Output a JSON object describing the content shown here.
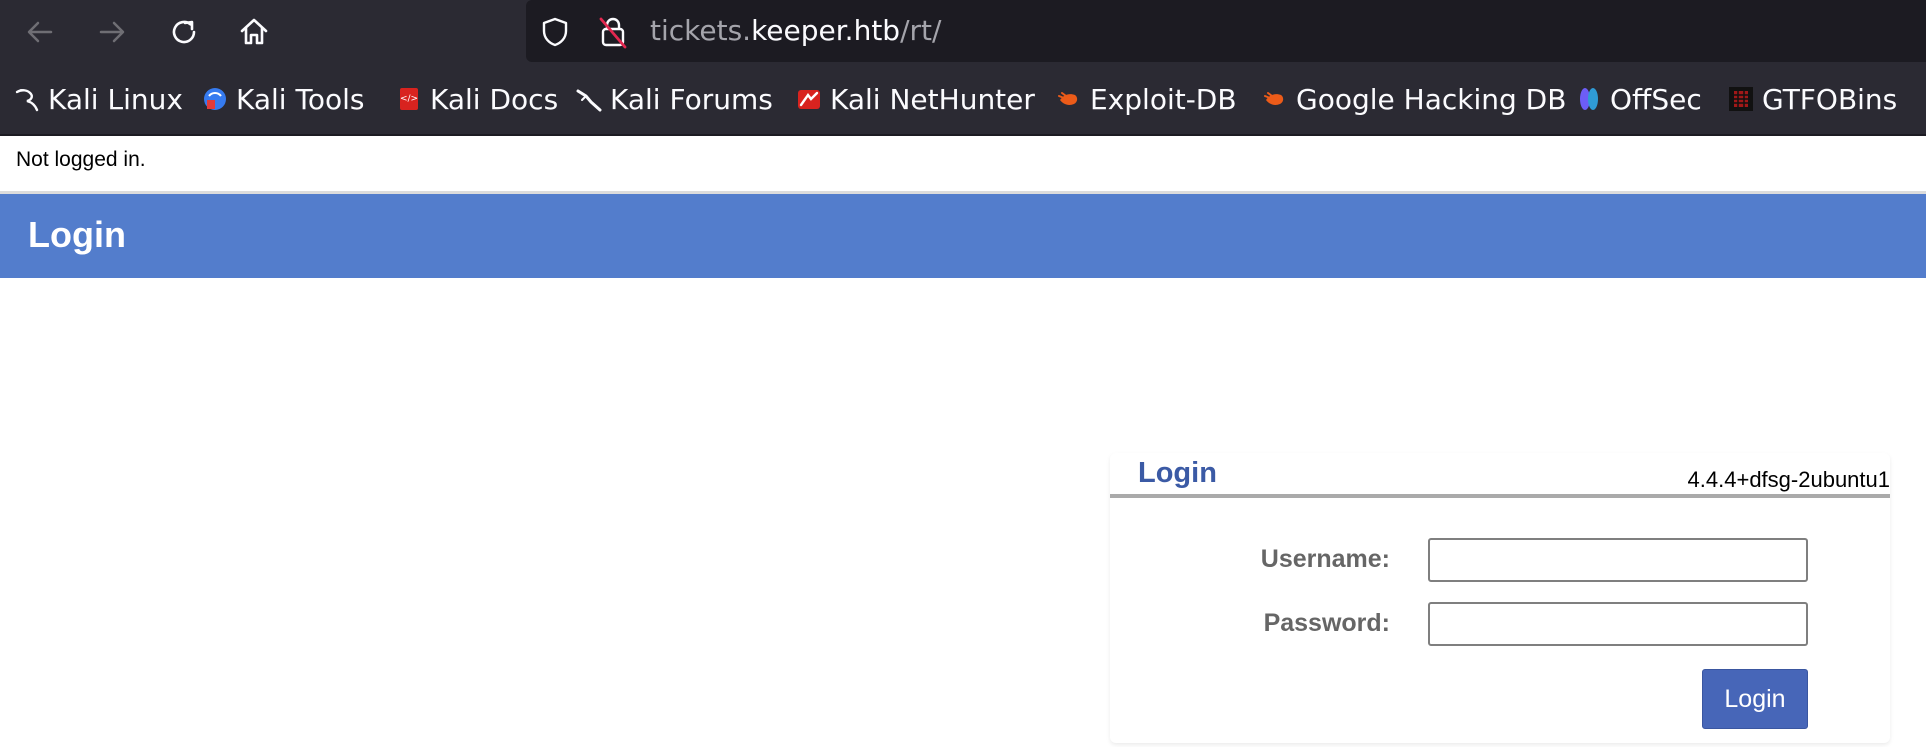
{
  "browser": {
    "url": {
      "prefix": "tickets.",
      "host": "keeper.htb",
      "path": "/rt/"
    },
    "nav_icons": [
      "back-arrow-icon",
      "forward-arrow-icon",
      "reload-icon",
      "home-icon"
    ],
    "bookmarks": [
      {
        "label": "Kali Linux",
        "icon": "kali-dragon-icon"
      },
      {
        "label": "Kali Tools",
        "icon": "kali-tools-icon"
      },
      {
        "label": "Kali Docs",
        "icon": "kali-docs-icon"
      },
      {
        "label": "Kali Forums",
        "icon": "kali-forums-icon"
      },
      {
        "label": "Kali NetHunter",
        "icon": "kali-nethunter-icon"
      },
      {
        "label": "Exploit-DB",
        "icon": "exploit-db-icon"
      },
      {
        "label": "Google Hacking DB",
        "icon": "google-hacking-db-icon"
      },
      {
        "label": "OffSec",
        "icon": "offsec-icon"
      },
      {
        "label": "GTFOBins",
        "icon": "gtfobins-icon"
      }
    ]
  },
  "page": {
    "status": "Not logged in.",
    "title": "Login"
  },
  "login_panel": {
    "title": "Login",
    "version": "4.4.4+dfsg-2ubuntu1",
    "username_label": "Username:",
    "username_value": "",
    "password_label": "Password:",
    "password_value": "",
    "submit_label": "Login"
  },
  "colors": {
    "toolbar": "#2b2a33",
    "urlbar": "#1c1b22",
    "title_band": "#537dcc",
    "panel_title": "#3b5aa5",
    "login_button": "#4766b8"
  }
}
